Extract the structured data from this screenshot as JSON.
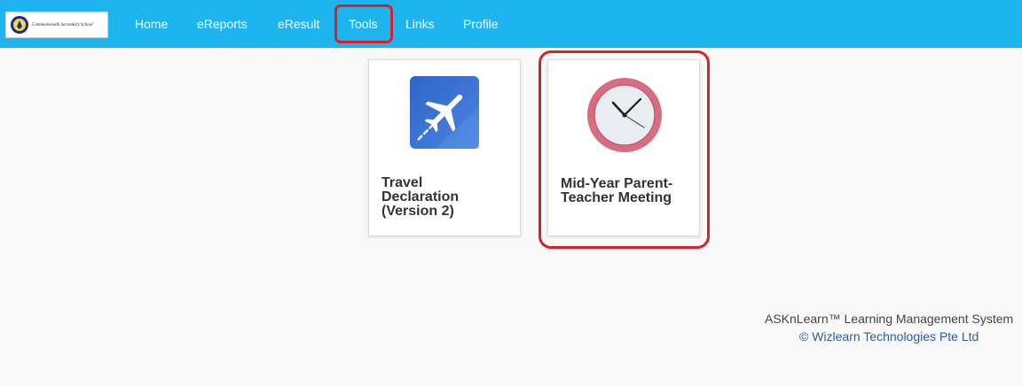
{
  "logo": {
    "school_name": "Commonwealth Secondary School"
  },
  "nav": {
    "items": [
      {
        "label": "Home"
      },
      {
        "label": "eReports"
      },
      {
        "label": "eResult"
      },
      {
        "label": "Tools"
      },
      {
        "label": "Links"
      },
      {
        "label": "Profile"
      }
    ],
    "active": "Tools"
  },
  "cards": [
    {
      "title": "Travel Declaration (Version 2)",
      "lines": [
        "Travel",
        "Declaration",
        "(Version 2)"
      ],
      "icon": "airplane-icon"
    },
    {
      "title": "Mid-Year Parent-Teacher Meeting",
      "lines": [
        "Mid-Year Parent-",
        "Teacher Meeting"
      ],
      "icon": "clock-icon"
    }
  ],
  "footer": {
    "system": "ASKnLearn™ Learning Management System",
    "copyright": "© Wizlearn Technologies Pte Ltd"
  },
  "colors": {
    "navbar": "#1eb4f0",
    "highlight": "#d9212e",
    "airplane_tile": "#3a6fd0",
    "clock_ring": "#d76e7f",
    "link": "#2a5d9e"
  }
}
